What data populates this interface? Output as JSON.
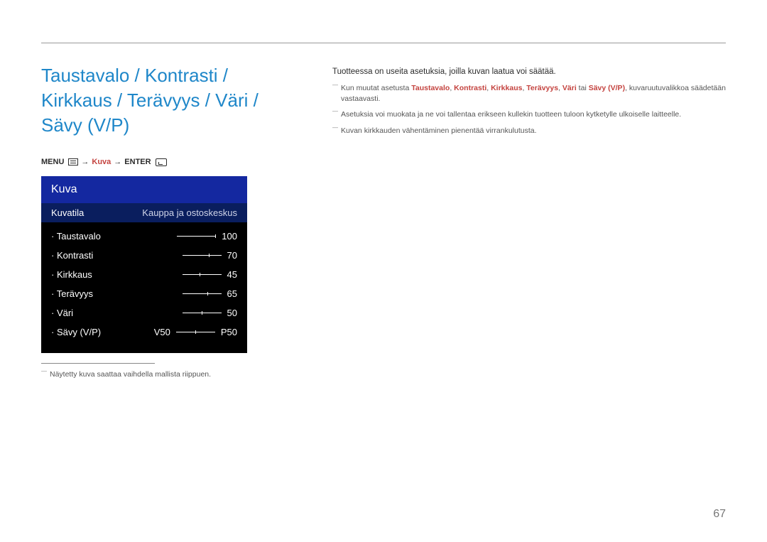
{
  "title": "Taustavalo / Kontrasti / Kirkkaus / Terävyys / Väri / Sävy (V/P)",
  "breadcrumb": {
    "menu": "MENU",
    "kuva": "Kuva",
    "enter": "ENTER",
    "arrow": "→"
  },
  "osd": {
    "title": "Kuva",
    "mode_label": "Kuvatila",
    "mode_value": "Kauppa ja ostoskeskus",
    "items": [
      {
        "label": "Taustavalo",
        "value": "100",
        "pos": 100
      },
      {
        "label": "Kontrasti",
        "value": "70",
        "pos": 70
      },
      {
        "label": "Kirkkaus",
        "value": "45",
        "pos": 45
      },
      {
        "label": "Terävyys",
        "value": "65",
        "pos": 65
      },
      {
        "label": "Väri",
        "value": "50",
        "pos": 50
      }
    ],
    "tint": {
      "label": "Sävy (V/P)",
      "left": "V50",
      "right": "P50"
    }
  },
  "left_note": "Näytetty kuva saattaa vaihdella mallista riippuen.",
  "intro": "Tuotteessa on useita asetuksia, joilla kuvan laatua voi säätää.",
  "bullet1": {
    "pre": "Kun muutat asetusta ",
    "hl": [
      "Taustavalo",
      "Kontrasti",
      "Kirkkaus",
      "Terävyys",
      "Väri",
      "Sävy (V/P)"
    ],
    "mid_or": " tai ",
    "post": ", kuvaruutuvalikkoa säädetään vastaavasti."
  },
  "bullet2": "Asetuksia voi muokata ja ne voi tallentaa erikseen kullekin tuotteen tuloon kytketylle ulkoiselle laitteelle.",
  "bullet3": "Kuvan kirkkauden vähentäminen pienentää virrankulutusta.",
  "page": "67"
}
